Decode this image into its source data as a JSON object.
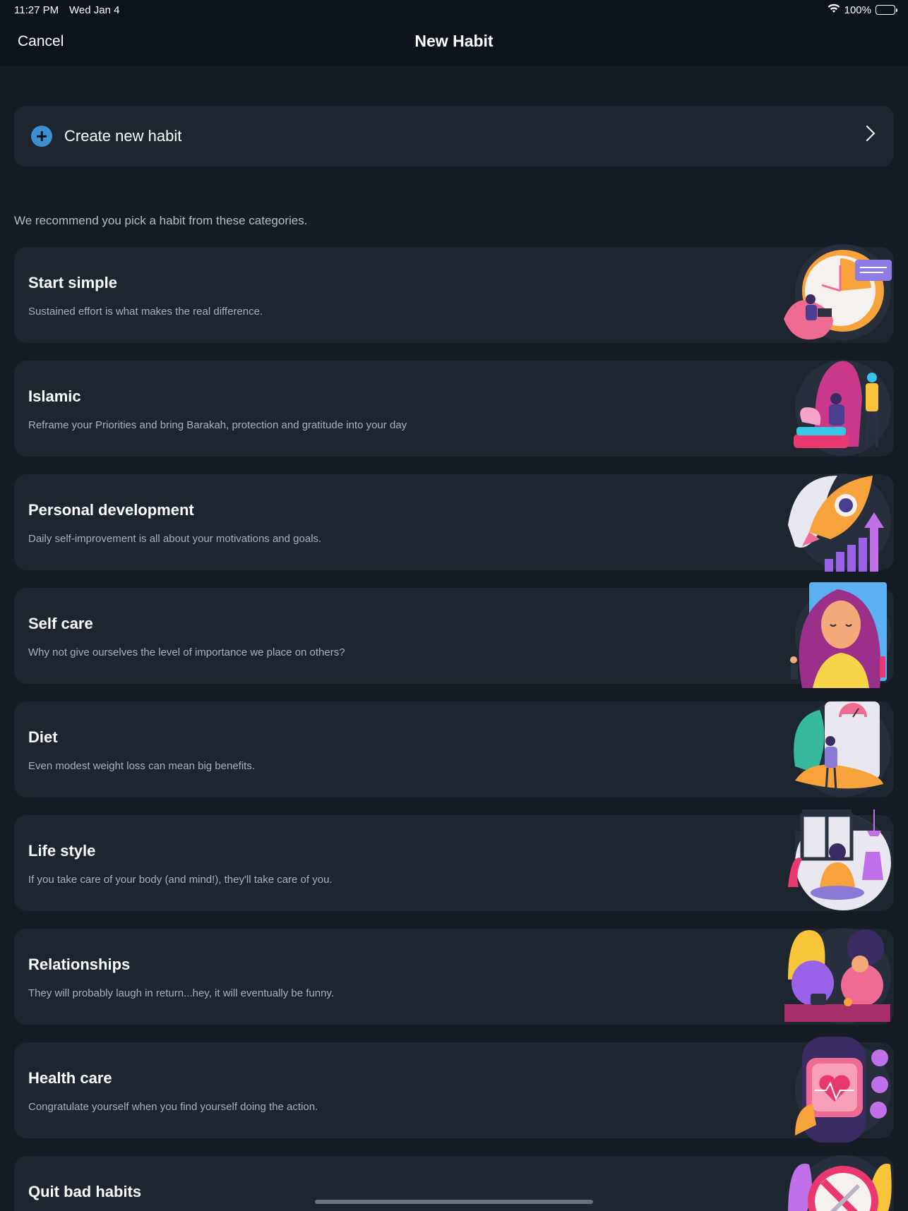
{
  "status": {
    "time": "11:27 PM",
    "date": "Wed Jan 4",
    "battery": "100%",
    "battery_level": 1.0
  },
  "nav": {
    "cancel_label": "Cancel",
    "title": "New Habit"
  },
  "create": {
    "label": "Create new habit"
  },
  "recommend_text": "We recommend you pick a habit from these categories.",
  "categories": [
    {
      "title": "Start simple",
      "desc": "Sustained effort is what makes the real difference."
    },
    {
      "title": "Islamic",
      "desc": "Reframe your Priorities and bring Barakah, protection and gratitude into your day"
    },
    {
      "title": "Personal development",
      "desc": "Daily self-improvement is all about your motivations and goals."
    },
    {
      "title": "Self care",
      "desc": "Why not give ourselves the level of importance we place on others?"
    },
    {
      "title": "Diet",
      "desc": "Even modest weight loss can mean big benefits."
    },
    {
      "title": "Life style",
      "desc": "If you take care of your body (and mind!), they'll take care of you."
    },
    {
      "title": "Relationships",
      "desc": "They will probably laugh in return...hey, it will eventually be funny."
    },
    {
      "title": "Health care",
      "desc": "Congratulate yourself when you find yourself doing the action."
    },
    {
      "title": "Quit bad habits",
      "desc": ""
    }
  ],
  "colors": {
    "background": "#151b22",
    "card": "#1d252f",
    "accent_blue": "#3d8fcf",
    "illustration_pink": "#f06b93",
    "illustration_orange": "#f7a23a",
    "illustration_purple": "#8f5ce6"
  }
}
